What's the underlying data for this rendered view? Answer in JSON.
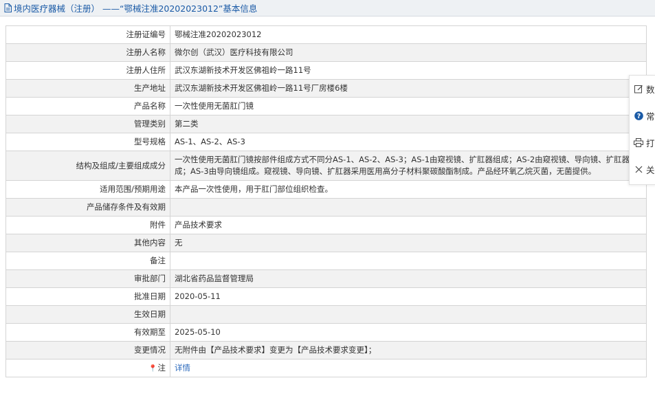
{
  "header": {
    "title": "境内医疗器械（注册） ——“鄂械注准20202023012”基本信息",
    "icon": "document-icon"
  },
  "rows": [
    {
      "label": "注册证编号",
      "value": "鄂械注准20202023012"
    },
    {
      "label": "注册人名称",
      "value": "微尔创（武汉）医疗科技有限公司"
    },
    {
      "label": "注册人住所",
      "value": "武汉东湖新技术开发区佛祖岭一路11号"
    },
    {
      "label": "生产地址",
      "value": "武汉东湖新技术开发区佛祖岭一路11号厂房楼6楼"
    },
    {
      "label": "产品名称",
      "value": "一次性使用无菌肛门镜"
    },
    {
      "label": "管理类别",
      "value": "第二类"
    },
    {
      "label": "型号规格",
      "value": "AS-1、AS-2、AS-3"
    },
    {
      "label": "结构及组成/主要组成成分",
      "value": "一次性使用无菌肛门镜按部件组成方式不同分AS-1、AS-2、AS-3；AS-1由窥视镜、扩肛器组成；AS-2由窥视镜、导向镜、扩肛器成；AS-3由导向镜组成。窥视镜、导向镜、扩肛器采用医用高分子材料聚碳酸酯制成。产品经环氧乙烷灭菌，无菌提供。"
    },
    {
      "label": "适用范围/预期用途",
      "value": "本产品一次性使用，用于肛门部位组织检查。"
    },
    {
      "label": "产品储存条件及有效期",
      "value": ""
    },
    {
      "label": "附件",
      "value": "产品技术要求"
    },
    {
      "label": "其他内容",
      "value": "无"
    },
    {
      "label": "备注",
      "value": ""
    },
    {
      "label": "审批部门",
      "value": "湖北省药品监督管理局"
    },
    {
      "label": "批准日期",
      "value": "2020-05-11"
    },
    {
      "label": "生效日期",
      "value": ""
    },
    {
      "label": "有效期至",
      "value": "2025-05-10"
    },
    {
      "label": "变更情况",
      "value": "无附件由【产品技术要求】变更为【产品技术要求变更】；"
    },
    {
      "label": "注",
      "value": "详情"
    }
  ],
  "side_panel": {
    "items": [
      {
        "label": "数",
        "icon": "edit-icon"
      },
      {
        "label": "常",
        "icon": "question-icon"
      },
      {
        "label": "打",
        "icon": "print-icon"
      },
      {
        "label": "关",
        "icon": "close-icon"
      }
    ]
  },
  "colors": {
    "title_text": "#1a5aa6",
    "link": "#2d6bbd",
    "row_alt": "#f2f2f2",
    "border": "#d4d4d4",
    "question_icon": "#1a5aa6"
  }
}
